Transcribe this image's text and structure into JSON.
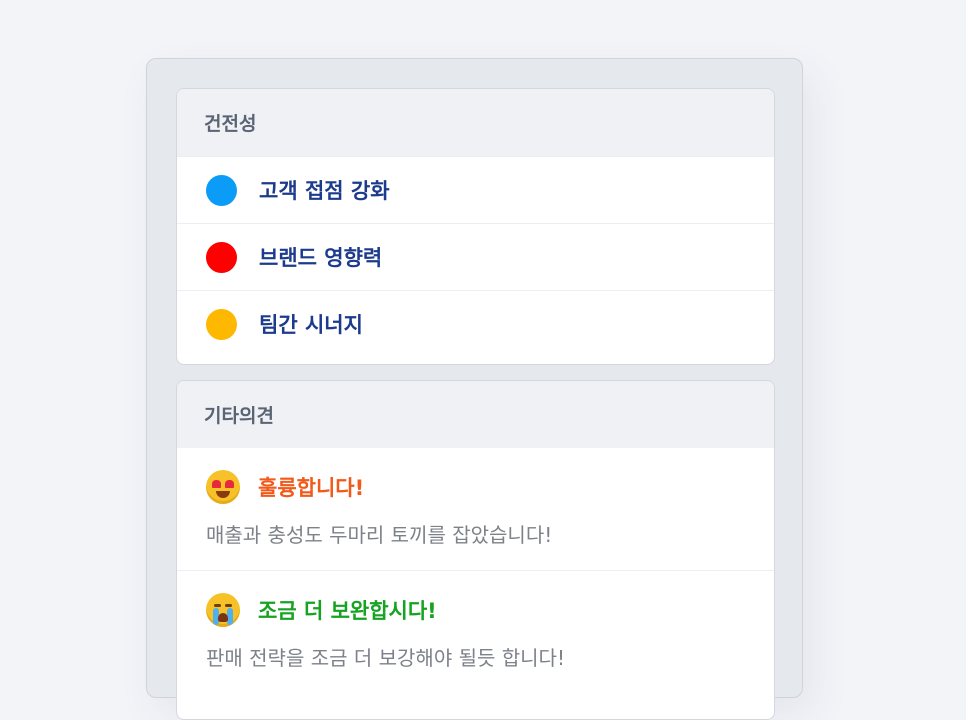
{
  "sections": {
    "health": {
      "title": "건전성",
      "items": [
        {
          "label": "고객 접점 강화",
          "color": "#0a9cf7"
        },
        {
          "label": "브랜드 영향력",
          "color": "#ff0000"
        },
        {
          "label": "팀간 시너지",
          "color": "#ffb800"
        }
      ]
    },
    "other": {
      "title": "기타의견",
      "items": [
        {
          "emoji": "heart-eyes-emoji",
          "title": "훌륭합니다!",
          "title_color": "#f15a1a",
          "body": "매출과 충성도 두마리 토끼를 잡았습니다!"
        },
        {
          "emoji": "crying-emoji",
          "title": "조금 더 보완합시다!",
          "title_color": "#16a322",
          "body": "판매 전략을 조금 더 보강해야 될듯 합니다!"
        }
      ]
    }
  }
}
